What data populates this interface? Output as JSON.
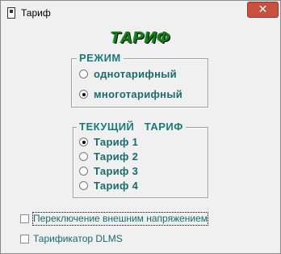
{
  "window": {
    "title": "Тариф",
    "close_glyph": "✕"
  },
  "heading": "ТАРИФ",
  "mode_group": {
    "legend": "РЕЖИМ",
    "options": [
      {
        "label": "однотарифный",
        "checked": false
      },
      {
        "label": "многотарифный",
        "checked": true
      }
    ]
  },
  "current_tariff_group": {
    "legend": "ТЕКУЩИЙ   ТАРИФ",
    "options": [
      {
        "label": "Тариф 1",
        "checked": true
      },
      {
        "label": "Тариф 2",
        "checked": false
      },
      {
        "label": "Тариф 3",
        "checked": false
      },
      {
        "label": "Тариф 4",
        "checked": false
      }
    ]
  },
  "checkboxes": [
    {
      "label": "Переключение внешним напряжением",
      "checked": false
    },
    {
      "label": "Тарификатор DLMS",
      "checked": false
    }
  ],
  "colors": {
    "heading": "#1a7a1a",
    "label": "#1a6b6b",
    "close_button": "#c94f40"
  }
}
